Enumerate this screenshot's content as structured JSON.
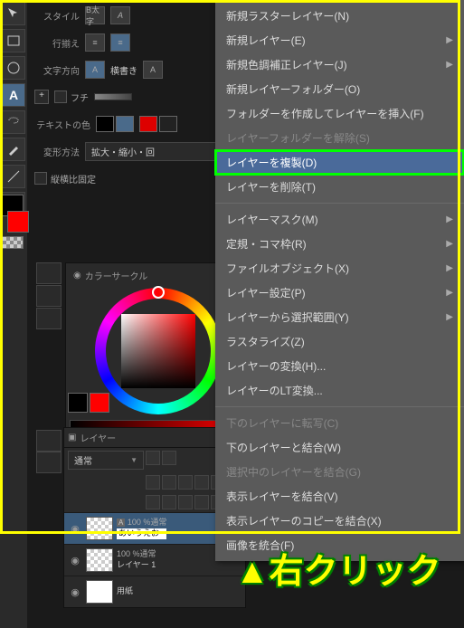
{
  "props": {
    "style_label": "スタイル",
    "bold": "B太字",
    "align_label": "行揃え",
    "direction_label": "文字方向",
    "direction_val": "横書き",
    "frame_label": "フチ",
    "textcolor_label": "テキストの色",
    "transform_label": "変形方法",
    "transform_val": "拡大・縮小・回",
    "aspect_lock": "縦横比固定"
  },
  "color_panel": {
    "title": "カラーサークル"
  },
  "layers_panel": {
    "title": "レイヤー",
    "blend": "通常",
    "items": [
      {
        "opacity": "100 %通常",
        "name": "あいうえお"
      },
      {
        "opacity": "100 %通常",
        "name": "レイヤー 1"
      },
      {
        "opacity": "",
        "name": "用紙"
      }
    ]
  },
  "ctx_menu": {
    "sec1": [
      {
        "t": "新規ラスターレイヤー(N)"
      },
      {
        "t": "新規レイヤー(E)",
        "sub": true
      },
      {
        "t": "新規色調補正レイヤー(J)",
        "sub": true
      },
      {
        "t": "新規レイヤーフォルダー(O)"
      },
      {
        "t": "フォルダーを作成してレイヤーを挿入(F)"
      },
      {
        "t": "レイヤーフォルダーを解除(S)",
        "dis": true
      },
      {
        "t": "レイヤーを複製(D)",
        "hov": true
      },
      {
        "t": "レイヤーを削除(T)"
      }
    ],
    "sec2": [
      {
        "t": "レイヤーマスク(M)",
        "sub": true
      },
      {
        "t": "定規・コマ枠(R)",
        "sub": true
      },
      {
        "t": "ファイルオブジェクト(X)",
        "sub": true
      },
      {
        "t": "レイヤー設定(P)",
        "sub": true
      },
      {
        "t": "レイヤーから選択範囲(Y)",
        "sub": true
      },
      {
        "t": "ラスタライズ(Z)"
      },
      {
        "t": "レイヤーの変換(H)..."
      },
      {
        "t": "レイヤーのLT変換..."
      }
    ],
    "sec3": [
      {
        "t": "下のレイヤーに転写(C)",
        "dis": true
      },
      {
        "t": "下のレイヤーと結合(W)"
      },
      {
        "t": "選択中のレイヤーを結合(G)",
        "dis": true
      },
      {
        "t": "表示レイヤーを結合(V)"
      },
      {
        "t": "表示レイヤーのコピーを結合(X)"
      },
      {
        "t": "画像を統合(F)"
      }
    ]
  },
  "annotation": "▲右クリック"
}
